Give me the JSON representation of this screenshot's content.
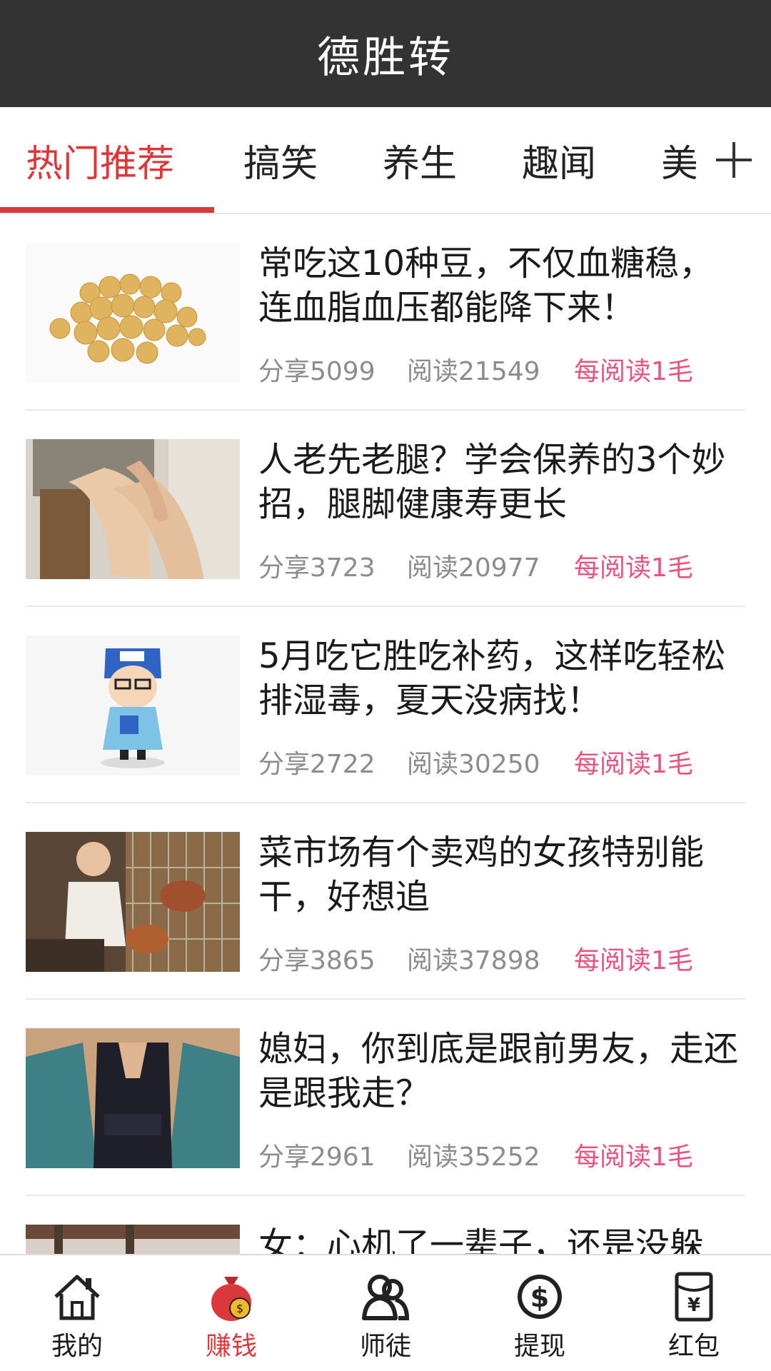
{
  "app": {
    "title": "德胜转"
  },
  "tabs": [
    {
      "label": "热门推荐",
      "active": true
    },
    {
      "label": "搞笑",
      "active": false
    },
    {
      "label": "养生",
      "active": false
    },
    {
      "label": "趣闻",
      "active": false
    },
    {
      "label": "美",
      "active": false
    }
  ],
  "tab_add_icon": "plus-icon",
  "articles": [
    {
      "title": "常吃这10种豆，不仅血糖稳，连血脂血压都能降下来！",
      "share": "分享5099",
      "read": "阅读21549",
      "reward": "每阅读1毛",
      "thumb": "soybeans-image"
    },
    {
      "title": "人老先老腿？学会保养的3个妙招，腿脚健康寿更长",
      "share": "分享3723",
      "read": "阅读20977",
      "reward": "每阅读1毛",
      "thumb": "legs-image"
    },
    {
      "title": "5月吃它胜吃补药，这样吃轻松排湿毒，夏天没病找！",
      "share": "分享2722",
      "read": "阅读30250",
      "reward": "每阅读1毛",
      "thumb": "cartoon-doctor-image"
    },
    {
      "title": "菜市场有个卖鸡的女孩特别能干，好想追",
      "share": "分享3865",
      "read": "阅读37898",
      "reward": "每阅读1毛",
      "thumb": "chicken-market-image"
    },
    {
      "title": "媳妇，你到底是跟前男友，走还是跟我走？",
      "share": "分享2961",
      "read": "阅读35252",
      "reward": "每阅读1毛",
      "thumb": "woman-dress-image"
    },
    {
      "title": "女：心机了一辈子，还是没躲",
      "share": "",
      "read": "",
      "reward": "",
      "thumb": "partial-image"
    }
  ],
  "nav": [
    {
      "label": "我的",
      "icon": "home-icon",
      "active": false
    },
    {
      "label": "赚钱",
      "icon": "money-bag-icon",
      "active": true
    },
    {
      "label": "师徒",
      "icon": "users-icon",
      "active": false
    },
    {
      "label": "提现",
      "icon": "dollar-coin-icon",
      "active": false
    },
    {
      "label": "红包",
      "icon": "red-envelope-icon",
      "active": false
    }
  ],
  "colors": {
    "header_bg": "#333333",
    "accent": "#d9393b",
    "reward": "#e8537f",
    "meta": "#8c8c8c"
  }
}
